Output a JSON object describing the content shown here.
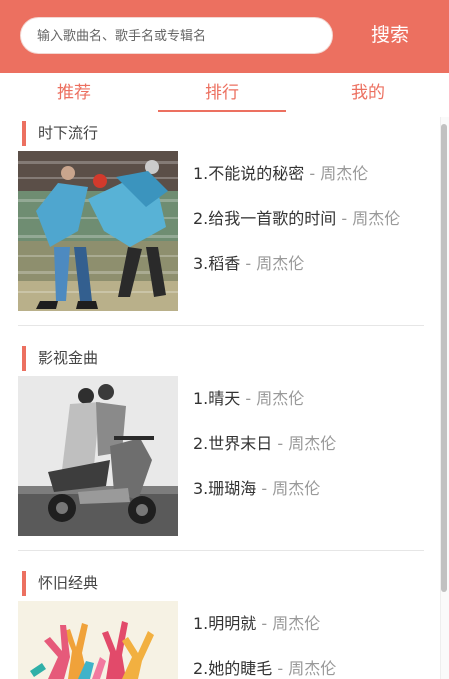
{
  "header": {
    "search_placeholder": "输入歌曲名、歌手名或专辑名",
    "search_button": "搜索"
  },
  "tabs": [
    {
      "label": "推荐",
      "active": false
    },
    {
      "label": "排行",
      "active": true
    },
    {
      "label": "我的",
      "active": false
    }
  ],
  "sections": [
    {
      "title": "时下流行",
      "songs": [
        {
          "name": "1.不能说的秘密",
          "separator": " - ",
          "artist": "周杰伦"
        },
        {
          "name": "2.给我一首歌的时间",
          "separator": " - ",
          "artist": "周杰伦"
        },
        {
          "name": "3.稻香",
          "separator": " - ",
          "artist": "周杰伦"
        }
      ]
    },
    {
      "title": "影视金曲",
      "songs": [
        {
          "name": "1.晴天",
          "separator": " - ",
          "artist": "周杰伦"
        },
        {
          "name": "2.世界末日",
          "separator": " - ",
          "artist": "周杰伦"
        },
        {
          "name": "3.珊瑚海",
          "separator": " - ",
          "artist": "周杰伦"
        }
      ]
    },
    {
      "title": "怀旧经典",
      "songs": [
        {
          "name": "1.明明就",
          "separator": " - ",
          "artist": "周杰伦"
        },
        {
          "name": "2.她的睫毛",
          "separator": " - ",
          "artist": "周杰伦"
        }
      ]
    }
  ],
  "colors": {
    "accent": "#EC7060",
    "artist": "#999999",
    "song": "#333333"
  }
}
